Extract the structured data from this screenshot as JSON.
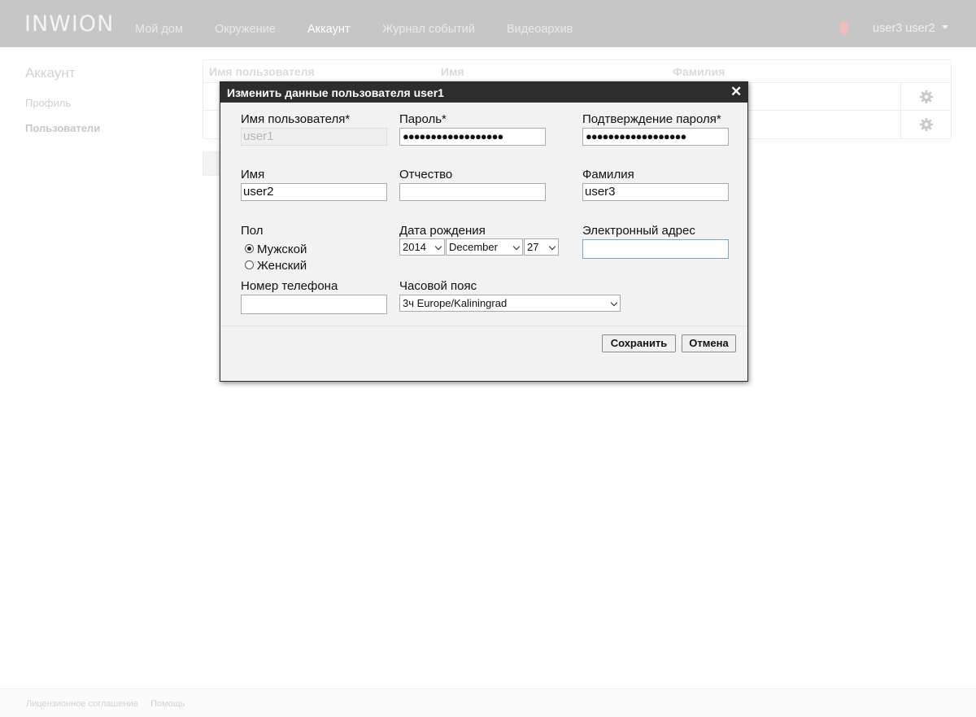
{
  "header": {
    "logo": "INWION",
    "nav": [
      {
        "label": "Мой дом"
      },
      {
        "label": "Окружение"
      },
      {
        "label": "Аккаунт"
      },
      {
        "label": "Журнал событий"
      },
      {
        "label": "Видеоархив"
      }
    ],
    "active_nav": "Аккаунт",
    "user_menu": "user3 user2",
    "icons": {
      "notifications": "bell-icon",
      "dropdown": "caret-down-icon"
    }
  },
  "sidebar": {
    "title": "Аккаунт",
    "items": [
      {
        "label": "Профиль"
      },
      {
        "label": "Пользователи"
      }
    ]
  },
  "users_table": {
    "columns": [
      "Имя пользователя",
      "Имя",
      "Фамилия"
    ],
    "row_icon": "gear-icon"
  },
  "footer": {
    "links": [
      "Лицензионное соглашение",
      "Помощь"
    ]
  },
  "dialog": {
    "title": "Изменить данные пользователя user1",
    "close_symbol": "✕",
    "fields": {
      "username": {
        "label": "Имя пользователя*",
        "value": "user1"
      },
      "password": {
        "label": "Пароль*",
        "value": "●●●●●●●●●●●●●●●●●●"
      },
      "password_confirm": {
        "label": "Подтверждение пароля*",
        "value": "●●●●●●●●●●●●●●●●●●"
      },
      "first_name": {
        "label": "Имя",
        "value": "user2"
      },
      "patronymic": {
        "label": "Отчество",
        "value": ""
      },
      "last_name": {
        "label": "Фамилия",
        "value": "user3"
      },
      "gender": {
        "label": "Пол",
        "options": [
          "Мужской",
          "Женский"
        ],
        "selected": "Мужской"
      },
      "birth_date": {
        "label": "Дата рождения",
        "year": "2014",
        "month": "December",
        "day": "27"
      },
      "email": {
        "label": "Электронный адрес",
        "value": ""
      },
      "phone": {
        "label": "Номер телефона",
        "value": ""
      },
      "timezone": {
        "label": "Часовой пояс",
        "value": "3ч Europe/Kaliningrad"
      }
    },
    "buttons": {
      "save": "Сохранить",
      "cancel": "Отмена"
    }
  },
  "colors": {
    "topbar": "#c6c6c6",
    "dialog_header": "#2d2d2d",
    "dialog_body": "#f2f2f2",
    "focus_border": "#7aa7c7"
  }
}
